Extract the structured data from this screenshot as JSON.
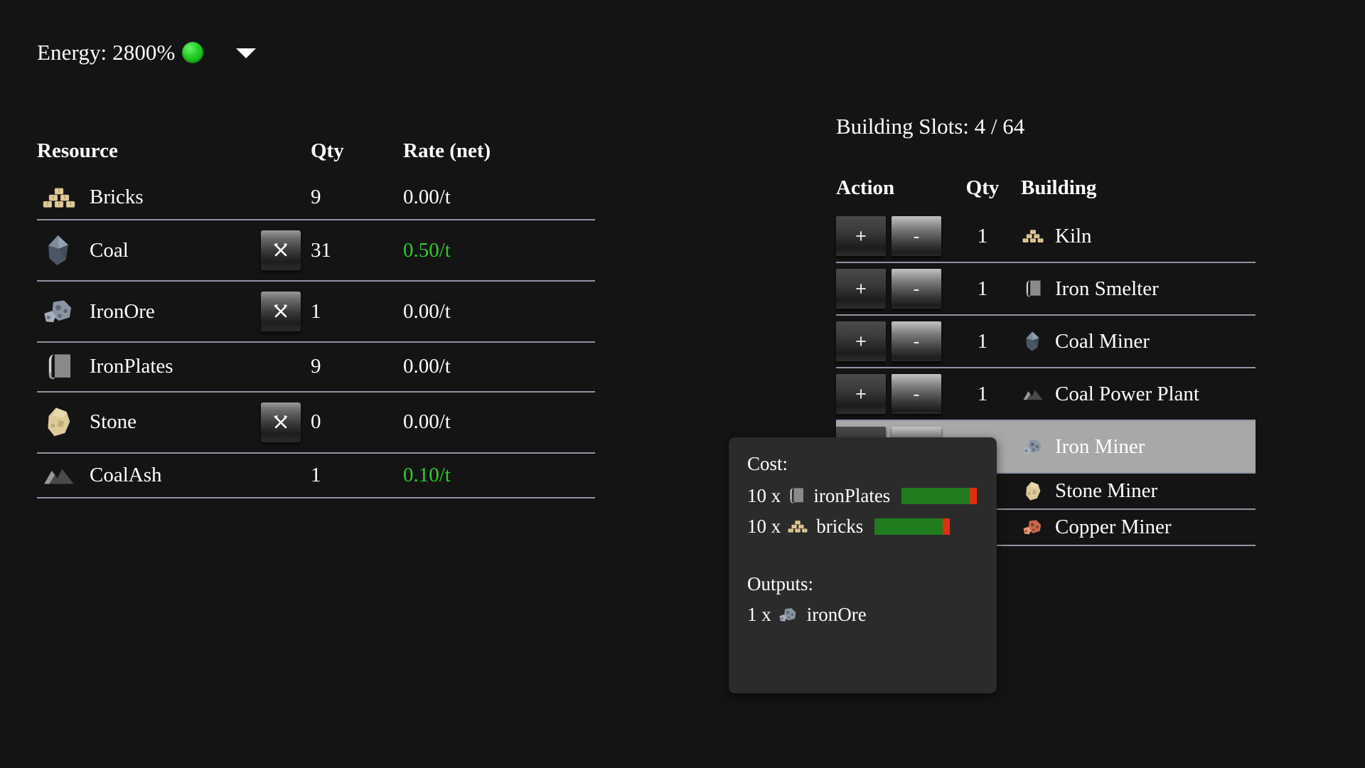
{
  "header": {
    "energy_label": "Energy: 2800%",
    "energy_status_color": "#22cc22",
    "caret_icon": "chevron-down-icon"
  },
  "resources": {
    "columns": [
      "Resource",
      "Qty",
      "Rate (net)"
    ],
    "mine_button_icon": "hammer-and-pick-icon",
    "rows": [
      {
        "icon": "bricks-icon",
        "name": "Bricks",
        "minable": false,
        "qty": "9",
        "rate": "0.00/t",
        "rate_positive": false
      },
      {
        "icon": "coal-icon",
        "name": "Coal",
        "minable": true,
        "qty": "31",
        "rate": "0.50/t",
        "rate_positive": true
      },
      {
        "icon": "iron-ore-icon",
        "name": "IronOre",
        "minable": true,
        "qty": "1",
        "rate": "0.00/t",
        "rate_positive": false
      },
      {
        "icon": "iron-plates-icon",
        "name": "IronPlates",
        "minable": false,
        "qty": "9",
        "rate": "0.00/t",
        "rate_positive": false
      },
      {
        "icon": "stone-icon",
        "name": "Stone",
        "minable": true,
        "qty": "0",
        "rate": "0.00/t",
        "rate_positive": false
      },
      {
        "icon": "coal-ash-icon",
        "name": "CoalAsh",
        "minable": false,
        "qty": "1",
        "rate": "0.10/t",
        "rate_positive": true
      }
    ]
  },
  "buildings": {
    "slots_label": "Building Slots: 4 / 64",
    "columns": [
      "Action",
      "Qty",
      "Building"
    ],
    "add_label": "+",
    "remove_label": "-",
    "rows": [
      {
        "icon": "kiln-icon",
        "name": "Kiln",
        "qty": "1",
        "has_actions": true,
        "highlighted": false
      },
      {
        "icon": "iron-smelter-icon",
        "name": "Iron Smelter",
        "qty": "1",
        "has_actions": true,
        "highlighted": false
      },
      {
        "icon": "coal-miner-icon",
        "name": "Coal Miner",
        "qty": "1",
        "has_actions": true,
        "highlighted": false
      },
      {
        "icon": "coal-power-plant-icon",
        "name": "Coal Power Plant",
        "qty": "1",
        "has_actions": true,
        "highlighted": false
      },
      {
        "icon": "iron-miner-icon",
        "name": "Iron Miner",
        "qty": "",
        "has_actions": true,
        "highlighted": true
      },
      {
        "icon": "stone-miner-icon",
        "name": "Stone Miner",
        "qty": "",
        "has_actions": false,
        "highlighted": false
      },
      {
        "icon": "copper-miner-icon",
        "name": "Copper Miner",
        "qty": "",
        "has_actions": false,
        "highlighted": false
      }
    ]
  },
  "tooltip": {
    "cost_heading": "Cost:",
    "outputs_heading": "Outputs:",
    "costs": [
      {
        "qty": "10 x",
        "icon": "iron-plates-icon",
        "name": "ironPlates",
        "progress": 90,
        "bar_fill_color": "#1f7c1f",
        "bar_empty_color": "#e03010"
      },
      {
        "qty": "10 x",
        "icon": "bricks-icon",
        "name": "bricks",
        "progress": 90,
        "bar_fill_color": "#1f7c1f",
        "bar_empty_color": "#e03010"
      }
    ],
    "outputs": [
      {
        "qty": "1 x",
        "icon": "iron-ore-icon",
        "name": "ironOre"
      }
    ]
  }
}
